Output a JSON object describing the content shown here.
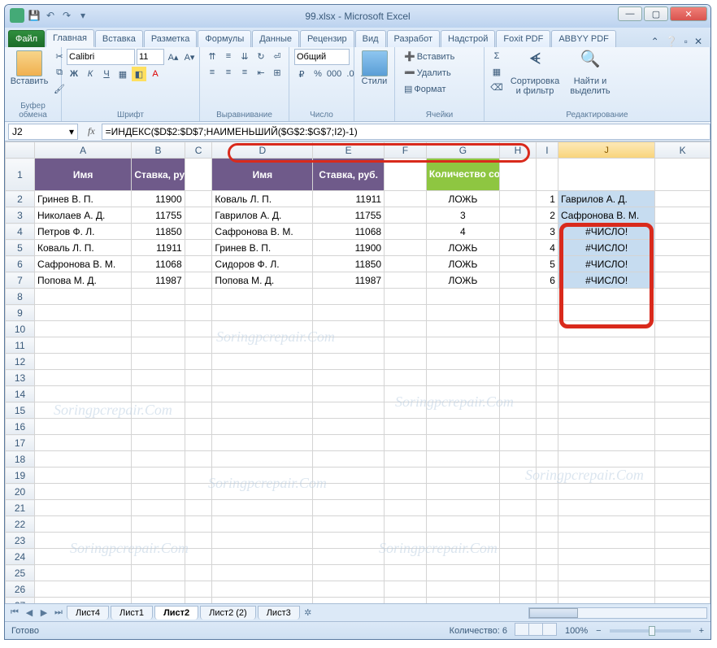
{
  "title": "99.xlsx - Microsoft Excel",
  "qat": {
    "save": "💾",
    "undo": "↶",
    "redo": "↷"
  },
  "tabs": {
    "file": "Файл",
    "items": [
      "Главная",
      "Вставка",
      "Разметка",
      "Формулы",
      "Данные",
      "Рецензир",
      "Вид",
      "Разработ",
      "Надстрой",
      "Foxit PDF",
      "ABBYY PDF"
    ],
    "active": 0
  },
  "ribbon": {
    "clipboard": {
      "paste": "Вставить",
      "label": "Буфер обмена"
    },
    "font": {
      "name": "Calibri",
      "size": "11",
      "label": "Шрифт"
    },
    "align": {
      "label": "Выравнивание"
    },
    "number": {
      "format": "Общий",
      "label": "Число"
    },
    "styles": {
      "btn": "Стили",
      "label": ""
    },
    "cells": {
      "insert": "Вставить",
      "delete": "Удалить",
      "format": "Формат",
      "label": "Ячейки"
    },
    "editing": {
      "sort": "Сортировка и фильтр",
      "find": "Найти и выделить",
      "label": "Редактирование"
    }
  },
  "namebox": "J2",
  "formula": "=ИНДЕКС($D$2:$D$7;НАИМЕНЬШИЙ($G$2:$G$7;I2)-1)",
  "columns": [
    "A",
    "B",
    "C",
    "D",
    "E",
    "F",
    "G",
    "H",
    "I",
    "J",
    "K"
  ],
  "table1": {
    "headers": [
      "Имя",
      "Ставка, руб."
    ],
    "rows": [
      [
        "Гринев В. П.",
        "11900"
      ],
      [
        "Николаев А. Д.",
        "11755"
      ],
      [
        "Петров Ф. Л.",
        "11850"
      ],
      [
        "Коваль Л. П.",
        "11911"
      ],
      [
        "Сафронова В. М.",
        "11068"
      ],
      [
        "Попова М. Д.",
        "11987"
      ]
    ]
  },
  "table2": {
    "headers": [
      "Имя",
      "Ставка, руб."
    ],
    "rows": [
      [
        "Коваль Л. П.",
        "11911"
      ],
      [
        "Гаврилов А. Д.",
        "11755"
      ],
      [
        "Сафронова В. М.",
        "11068"
      ],
      [
        "Гринев В. П.",
        "11900"
      ],
      [
        "Сидоров Ф. Л.",
        "11850"
      ],
      [
        "Попова М. Д.",
        "11987"
      ]
    ]
  },
  "colG": {
    "header": "Количество совпадений",
    "vals": [
      "ЛОЖЬ",
      "3",
      "4",
      "ЛОЖЬ",
      "ЛОЖЬ",
      "ЛОЖЬ"
    ]
  },
  "colI": [
    "1",
    "2",
    "3",
    "4",
    "5",
    "6"
  ],
  "colJ": [
    "Гаврилов А. Д.",
    "Сафронова В. М.",
    "#ЧИСЛО!",
    "#ЧИСЛО!",
    "#ЧИСЛО!",
    "#ЧИСЛО!"
  ],
  "sheets": {
    "items": [
      "Лист4",
      "Лист1",
      "Лист2",
      "Лист2 (2)",
      "Лист3"
    ],
    "active": 2
  },
  "status": {
    "ready": "Готово",
    "count": "Количество: 6",
    "zoom": "100%"
  },
  "watermark": "Soringpcrepair.Com"
}
